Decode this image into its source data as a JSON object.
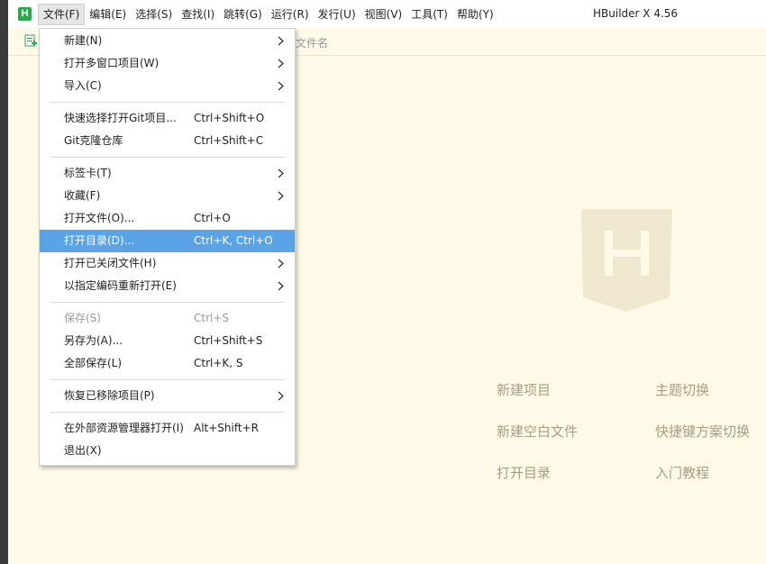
{
  "app": {
    "logo_letter": "H",
    "title": "HBuilder X 4.56"
  },
  "menubar": [
    {
      "label": "文件(F)",
      "active": true
    },
    {
      "label": "编辑(E)"
    },
    {
      "label": "选择(S)"
    },
    {
      "label": "查找(I)"
    },
    {
      "label": "跳转(G)"
    },
    {
      "label": "运行(R)"
    },
    {
      "label": "发行(U)"
    },
    {
      "label": "视图(V)"
    },
    {
      "label": "工具(T)"
    },
    {
      "label": "帮助(Y)"
    }
  ],
  "toolbar": {
    "search_placeholder_tail": "文件名"
  },
  "file_menu": {
    "new": {
      "label": "新建(N)"
    },
    "open_multi": {
      "label": "打开多窗口项目(W)"
    },
    "import": {
      "label": "导入(C)"
    },
    "git_open": {
      "label": "快速选择打开Git项目...",
      "shortcut": "Ctrl+Shift+O"
    },
    "git_clone": {
      "label": "Git克隆仓库",
      "shortcut": "Ctrl+Shift+C"
    },
    "tabs": {
      "label": "标签卡(T)"
    },
    "favorites": {
      "label": "收藏(F)"
    },
    "open_file": {
      "label": "打开文件(O)...",
      "shortcut": "Ctrl+O"
    },
    "open_dir": {
      "label": "打开目录(D)...",
      "shortcut": "Ctrl+K, Ctrl+O"
    },
    "open_closed": {
      "label": "打开已关闭文件(H)"
    },
    "reopen_encoding": {
      "label": "以指定编码重新打开(E)"
    },
    "save": {
      "label": "保存(S)",
      "shortcut": "Ctrl+S"
    },
    "save_as": {
      "label": "另存为(A)...",
      "shortcut": "Ctrl+Shift+S"
    },
    "save_all": {
      "label": "全部保存(L)",
      "shortcut": "Ctrl+K, S"
    },
    "restore_removed": {
      "label": "恢复已移除项目(P)"
    },
    "open_explorer": {
      "label": "在外部资源管理器打开(I)",
      "shortcut": "Alt+Shift+R"
    },
    "exit": {
      "label": "退出(X)"
    }
  },
  "welcome": {
    "logo_letter": "H",
    "links": {
      "new_project": "新建项目",
      "theme": "主题切换",
      "new_blank": "新建空白文件",
      "keymap": "快捷键方案切换",
      "open_dir": "打开目录",
      "tutorial": "入门教程"
    }
  },
  "colors": {
    "accent_highlight": "#5aa3e6",
    "logo_green": "#2ca84e",
    "editor_bg": "#fffae8",
    "welcome_logo": "#efe8ce",
    "link_text": "#a59e7f"
  }
}
